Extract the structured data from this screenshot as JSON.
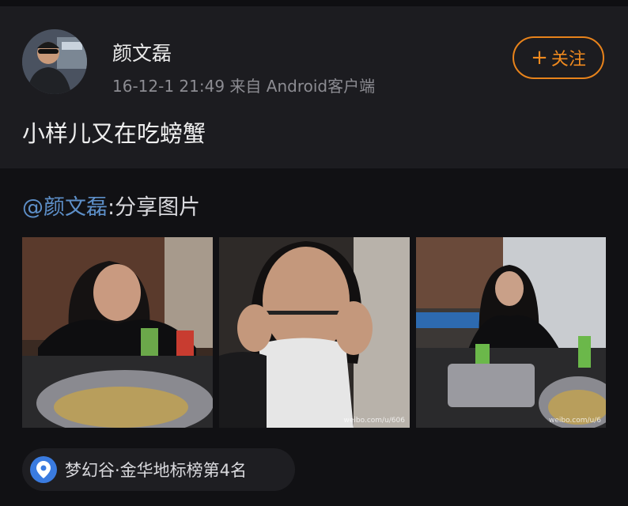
{
  "post": {
    "username": "颜文磊",
    "timestamp": "16-12-1 21:49",
    "source": "来自 Android客户端",
    "follow_label": "关注",
    "text": "小样儿又在吃螃蟹"
  },
  "repost": {
    "mention": "@颜文磊",
    "suffix": ":分享图片",
    "photos": [
      {
        "watermark": ""
      },
      {
        "watermark": "weibo.com/u/606"
      },
      {
        "watermark": "weibo.com/u/6"
      }
    ]
  },
  "location": {
    "label": "梦幻谷·金华地标榜第4名"
  },
  "icons": [
    "plus-icon",
    "location-pin-icon"
  ],
  "colors": {
    "follow_accent": "#e8831b",
    "mention_link": "#5d8fc8",
    "pin_blue": "#3a7be0"
  }
}
